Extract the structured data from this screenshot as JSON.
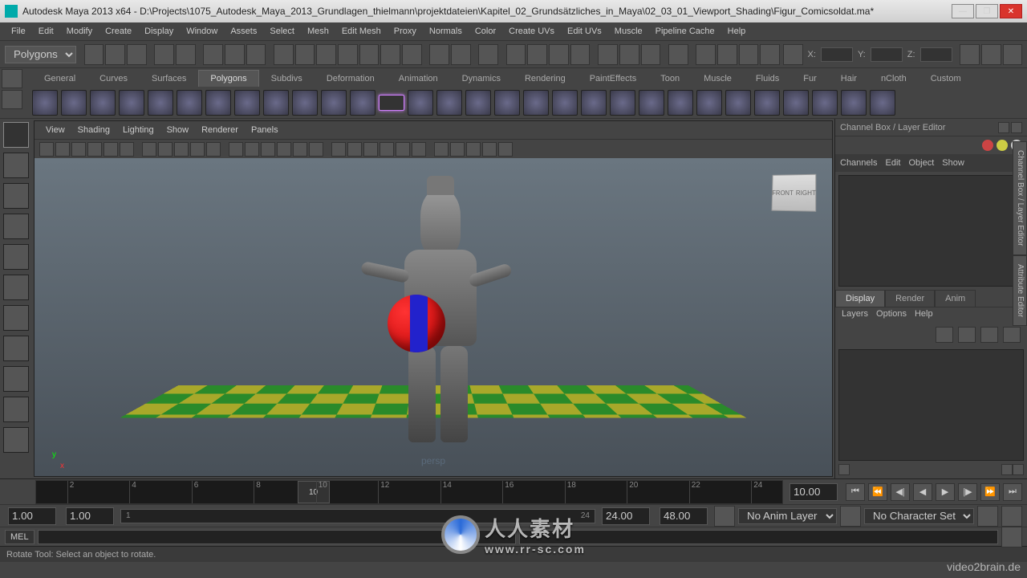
{
  "window": {
    "title": "Autodesk Maya 2013 x64 - D:\\Projects\\1075_Autodesk_Maya_2013_Grundlagen_thielmann\\projektdateien\\Kapitel_02_Grundsätzliches_in_Maya\\02_03_01_Viewport_Shading\\Figur_Comicsoldat.ma*"
  },
  "menubar": [
    "File",
    "Edit",
    "Modify",
    "Create",
    "Display",
    "Window",
    "Assets",
    "Select",
    "Mesh",
    "Edit Mesh",
    "Proxy",
    "Normals",
    "Color",
    "Create UVs",
    "Edit UVs",
    "Muscle",
    "Pipeline Cache",
    "Help"
  ],
  "mode_selector": "Polygons",
  "status_axes": {
    "x": "X:",
    "y": "Y:",
    "z": "Z:"
  },
  "shelf_tabs": [
    "General",
    "Curves",
    "Surfaces",
    "Polygons",
    "Subdivs",
    "Deformation",
    "Animation",
    "Dynamics",
    "Rendering",
    "PaintEffects",
    "Toon",
    "Muscle",
    "Fluids",
    "Fur",
    "Hair",
    "nCloth",
    "Custom"
  ],
  "shelf_tab_active": 3,
  "shelf_btn_count": 30,
  "shelf_btn_selected": 12,
  "tool_count": 11,
  "tool_active": 0,
  "viewport": {
    "menu": [
      "View",
      "Shading",
      "Lighting",
      "Show",
      "Renderer",
      "Panels"
    ],
    "camera": "persp",
    "viewcube": {
      "front": "FRONT",
      "right": "RIGHT"
    },
    "axis": {
      "x": "x",
      "y": "y"
    }
  },
  "channel_box": {
    "title": "Channel Box / Layer Editor",
    "top_tabs": [
      "Channels",
      "Edit",
      "Object",
      "Show"
    ],
    "sub_tabs": [
      "Display",
      "Render",
      "Anim"
    ],
    "sub_tab_active": 0,
    "layer_menu": [
      "Layers",
      "Options",
      "Help"
    ]
  },
  "side_tabs": [
    "Channel Box / Layer Editor",
    "Attribute Editor"
  ],
  "timeline": {
    "ticks": [
      2,
      4,
      6,
      8,
      10,
      12,
      14,
      16,
      18,
      20,
      22,
      24
    ],
    "marker_frame": "10",
    "current": "10.00"
  },
  "range": {
    "start_outer": "1.00",
    "start_inner": "1.00",
    "track_start": "1",
    "track_end": "24",
    "end_inner": "24.00",
    "end_outer": "48.00",
    "anim_layer": "No Anim Layer",
    "char_set": "No Character Set"
  },
  "command": {
    "lang": "MEL"
  },
  "status": "Rotate Tool: Select an object to rotate.",
  "watermark": {
    "cn": "人人素材",
    "url": "www.rr-sc.com",
    "brand": "video2brain.de"
  }
}
